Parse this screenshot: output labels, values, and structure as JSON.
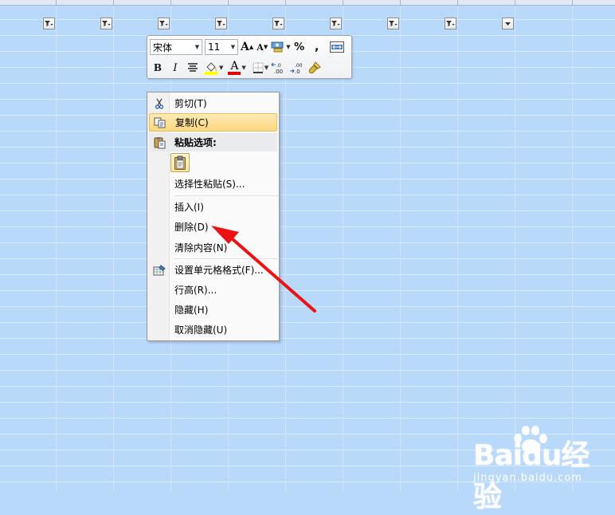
{
  "mini_toolbar": {
    "font_name": "宋体",
    "font_size": "11",
    "grow_font": "A",
    "shrink_font": "A",
    "percent": "%",
    "comma": ",",
    "bold": "B",
    "italic": "I",
    "font_color_letter": "A",
    "inc_decimal": ".00",
    "dec_decimal": ".00",
    "highlight_color": "#ffff00",
    "font_color": "#e00000"
  },
  "context_menu": {
    "items": [
      {
        "label": "剪切(T)",
        "icon": "scissors-icon"
      },
      {
        "label": "复制(C)",
        "icon": "copy-icon"
      },
      {
        "label": "粘贴选项:",
        "icon": "paste-icon"
      },
      {
        "label": "选择性粘贴(S)...",
        "icon": ""
      },
      {
        "label": "插入(I)",
        "icon": ""
      },
      {
        "label": "删除(D)",
        "icon": ""
      },
      {
        "label": "清除内容(N)",
        "icon": ""
      },
      {
        "label": "设置单元格格式(F)...",
        "icon": "format-cells-icon"
      },
      {
        "label": "行高(R)...",
        "icon": ""
      },
      {
        "label": "隐藏(H)",
        "icon": ""
      },
      {
        "label": "取消隐藏(U)",
        "icon": ""
      }
    ],
    "highlighted_item": "复制(C)"
  },
  "annotation": {
    "arrow_color": "#ee1111",
    "points_to": "删除(D)"
  },
  "watermark": {
    "logo": "Baidu经验",
    "url": "jingyan.baidu.com"
  }
}
